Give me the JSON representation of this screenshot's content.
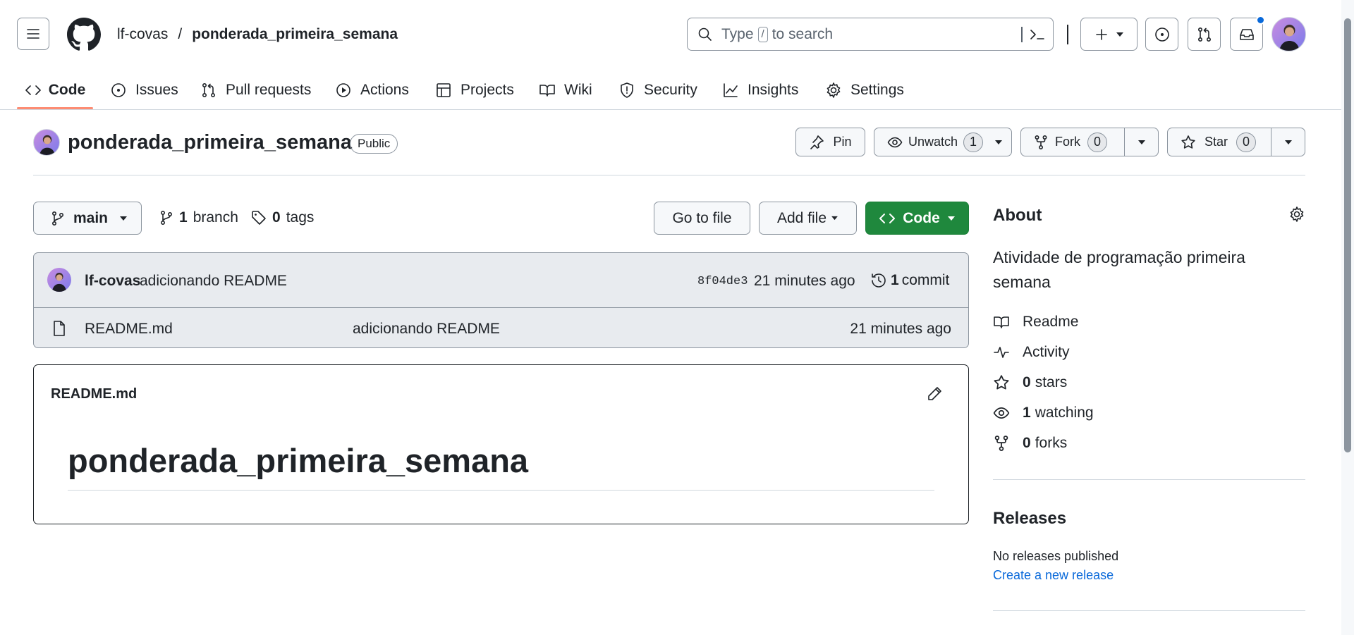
{
  "header": {
    "owner": "lf-covas",
    "separator": "/",
    "repo": "ponderada_primeira_semana",
    "search": {
      "prefix": "Type",
      "key": "/",
      "suffix": "to search"
    }
  },
  "nav": {
    "tabs": [
      {
        "label": "Code",
        "icon": "code-icon",
        "active": true
      },
      {
        "label": "Issues",
        "icon": "issue-opened-icon"
      },
      {
        "label": "Pull requests",
        "icon": "git-pull-request-icon"
      },
      {
        "label": "Actions",
        "icon": "play-icon"
      },
      {
        "label": "Projects",
        "icon": "table-icon"
      },
      {
        "label": "Wiki",
        "icon": "book-icon"
      },
      {
        "label": "Security",
        "icon": "shield-icon"
      },
      {
        "label": "Insights",
        "icon": "graph-icon"
      },
      {
        "label": "Settings",
        "icon": "gear-icon"
      }
    ]
  },
  "repo_header": {
    "name": "ponderada_primeira_semana",
    "visibility": "Public",
    "pin_label": "Pin",
    "unwatch_label": "Unwatch",
    "watch_count": "1",
    "fork_label": "Fork",
    "fork_count": "0",
    "star_label": "Star",
    "star_count": "0"
  },
  "toolbar": {
    "branch": "main",
    "branch_count": "1",
    "branch_label": "branch",
    "tag_count": "0",
    "tag_label": "tags",
    "go_to_file": "Go to file",
    "add_file": "Add file",
    "code": "Code"
  },
  "latest_commit": {
    "author": "lf-covas",
    "message": "adicionando README",
    "sha": "8f04de3",
    "time": "21 minutes ago",
    "commit_count": "1",
    "commit_label": "commit"
  },
  "files": [
    {
      "name": "README.md",
      "message": "adicionando README",
      "time": "21 minutes ago"
    }
  ],
  "readme": {
    "filename": "README.md",
    "heading": "ponderada_primeira_semana"
  },
  "about": {
    "title": "About",
    "description": "Atividade de programação primeira semana",
    "readme": "Readme",
    "activity": "Activity",
    "stars_count": "0",
    "stars_label": "stars",
    "watching_count": "1",
    "watching_label": "watching",
    "forks_count": "0",
    "forks_label": "forks"
  },
  "releases": {
    "title": "Releases",
    "none": "No releases published",
    "create": "Create a new release"
  },
  "colors": {
    "accent_green": "#1f883d",
    "link_blue": "#0969da",
    "active_tab": "#fd8c73",
    "notification_dot": "#0969da"
  }
}
